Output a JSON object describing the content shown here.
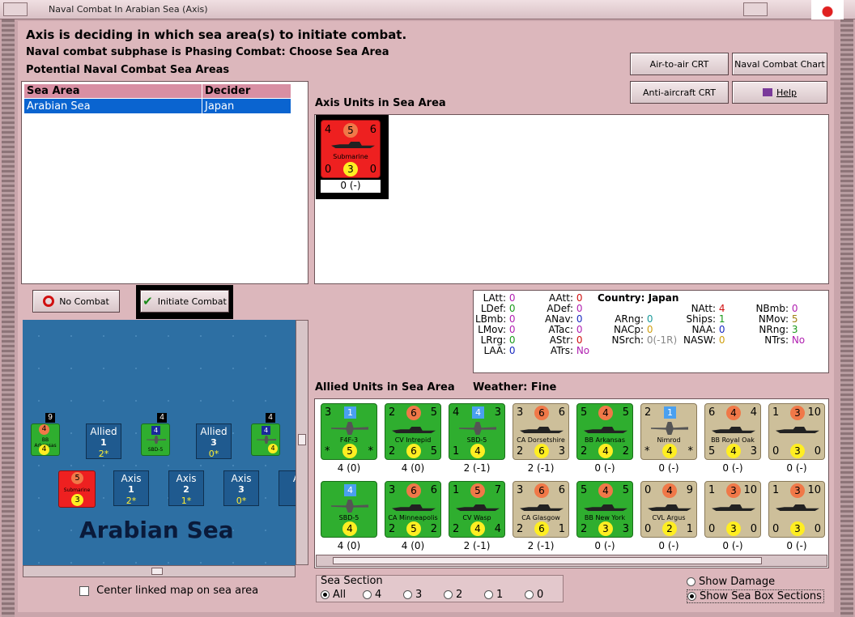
{
  "window": {
    "title": "Naval Combat In Arabian Sea (Axis)"
  },
  "header": {
    "line1": "Axis is deciding in which sea area(s) to initiate combat.",
    "line2": "Naval combat subphase is Phasing Combat: Choose Sea Area",
    "line3": "Potential Naval Combat Sea Areas"
  },
  "buttons": {
    "air_to_air": "Air-to-air CRT",
    "naval_combat_chart": "Naval Combat Chart",
    "anti_aircraft": "Anti-aircraft CRT",
    "help": "Help",
    "no_combat": "No Combat",
    "initiate_combat": "Initiate Combat"
  },
  "sea_table": {
    "headers": [
      "Sea Area",
      "Decider"
    ],
    "rows": [
      [
        "Arabian Sea",
        "Japan"
      ]
    ]
  },
  "axis_units": {
    "title": "Axis Units in Sea Area",
    "units": [
      {
        "name": "Submarine",
        "tl": "4",
        "tc": "5",
        "tr": "6",
        "bl": "0",
        "bc": "3",
        "br": "0",
        "label": "0 (-)"
      }
    ]
  },
  "stats": {
    "country_label": "Country:",
    "country": "Japan",
    "col1": [
      [
        "LAtt:",
        "0"
      ],
      [
        "LDef:",
        "0"
      ],
      [
        "LBmb:",
        "0"
      ],
      [
        "LMov:",
        "0"
      ],
      [
        "LRrg:",
        "0"
      ],
      [
        "LAA:",
        "0"
      ]
    ],
    "col2": [
      [
        "AAtt:",
        "0"
      ],
      [
        "ADef:",
        "0"
      ],
      [
        "ANav:",
        "0"
      ],
      [
        "ATac:",
        "0"
      ],
      [
        "AStr:",
        "0"
      ],
      [
        "ATrs:",
        "No"
      ]
    ],
    "col3": [
      [
        "ARng:",
        "0"
      ],
      [
        "NACp:",
        "0"
      ],
      [
        "NSrch:",
        "0(-1R)"
      ]
    ],
    "col4": [
      [
        "NAtt:",
        "4"
      ],
      [
        "Ships:",
        "1"
      ],
      [
        "NAA:",
        "0"
      ],
      [
        "NASW:",
        "0"
      ]
    ],
    "col5": [
      [
        "NBmb:",
        "0"
      ],
      [
        "NMov:",
        "5"
      ],
      [
        "NRng:",
        "3"
      ],
      [
        "NTrs:",
        "No"
      ]
    ]
  },
  "allied": {
    "title": "Allied Units in Sea Area",
    "weather_label": "Weather:",
    "weather": "Fine",
    "row1": [
      {
        "name": "F4F-3",
        "color": "green",
        "kind": "plane",
        "tl": "3",
        "tc": "1",
        "tr": "",
        "bl": "*",
        "bc": "5",
        "br": "*",
        "label": "4 (0)"
      },
      {
        "name": "CV Intrepid",
        "color": "green",
        "kind": "ship",
        "tl": "2",
        "tc": "6",
        "tr": "5",
        "bl": "2",
        "bc": "6",
        "br": "5",
        "label": "4 (0)"
      },
      {
        "name": "SBD-5",
        "color": "green",
        "kind": "plane",
        "tl": "4",
        "tc": "4",
        "tr": "3",
        "bl": "1",
        "bc": "4",
        "br": "",
        "label": "2 (-1)"
      },
      {
        "name": "CA Dorsetshire",
        "color": "tan",
        "kind": "ship",
        "tl": "3",
        "tc": "6",
        "tr": "6",
        "bl": "2",
        "bc": "6",
        "br": "3",
        "label": "2 (-1)"
      },
      {
        "name": "BB Arkansas",
        "color": "green",
        "kind": "ship",
        "tl": "5",
        "tc": "4",
        "tr": "5",
        "bl": "2",
        "bc": "4",
        "br": "2",
        "label": "0 (-)"
      },
      {
        "name": "Nimrod",
        "color": "tan",
        "kind": "plane",
        "tl": "2",
        "tc": "1",
        "tr": "",
        "bl": "*",
        "bc": "4",
        "br": "*",
        "label": "0 (-)"
      },
      {
        "name": "BB Royal Oak",
        "color": "tan",
        "kind": "ship",
        "tl": "6",
        "tc": "4",
        "tr": "4",
        "bl": "5",
        "bc": "4",
        "br": "3",
        "label": "0 (-)"
      },
      {
        "name": "",
        "color": "tan",
        "kind": "ship",
        "tl": "1",
        "tc": "3",
        "tr": "10",
        "bl": "0",
        "bc": "3",
        "br": "0",
        "label": "0 (-)"
      }
    ],
    "row2": [
      {
        "name": "SBD-5",
        "color": "green",
        "kind": "plane",
        "tl": "",
        "tc": "4",
        "tr": "",
        "bl": "",
        "bc": "4",
        "br": "",
        "label": "4 (0)"
      },
      {
        "name": "CA Minneapolis",
        "color": "green",
        "kind": "ship",
        "tl": "3",
        "tc": "6",
        "tr": "6",
        "bl": "2",
        "bc": "5",
        "br": "2",
        "label": "4 (0)"
      },
      {
        "name": "CV Wasp",
        "color": "green",
        "kind": "ship",
        "tl": "1",
        "tc": "5",
        "tr": "7",
        "bl": "2",
        "bc": "4",
        "br": "4",
        "label": "2 (-1)"
      },
      {
        "name": "CA Glasgow",
        "color": "tan",
        "kind": "ship",
        "tl": "3",
        "tc": "6",
        "tr": "6",
        "bl": "2",
        "bc": "6",
        "br": "1",
        "label": "2 (-1)"
      },
      {
        "name": "BB New York",
        "color": "green",
        "kind": "ship",
        "tl": "5",
        "tc": "4",
        "tr": "5",
        "bl": "2",
        "bc": "3",
        "br": "3",
        "label": "0 (-)"
      },
      {
        "name": "CVL Argus",
        "color": "tan",
        "kind": "ship",
        "tl": "0",
        "tc": "4",
        "tr": "9",
        "bl": "0",
        "bc": "2",
        "br": "1",
        "label": "0 (-)"
      },
      {
        "name": "",
        "color": "tan",
        "kind": "ship",
        "tl": "1",
        "tc": "3",
        "tr": "10",
        "bl": "0",
        "bc": "3",
        "br": "0",
        "label": "0 (-)"
      },
      {
        "name": "",
        "color": "tan",
        "kind": "ship",
        "tl": "1",
        "tc": "3",
        "tr": "10",
        "bl": "0",
        "bc": "3",
        "br": "0",
        "label": "0 (-)"
      }
    ]
  },
  "map": {
    "sea_name": "Arabian Sea",
    "allied_boxes": [
      {
        "side": "Allied",
        "num": "1",
        "sub": "2*"
      },
      {
        "side": "Allied",
        "num": "3",
        "sub": "0*"
      }
    ],
    "axis_boxes": [
      {
        "side": "Axis",
        "num": "1",
        "sub": "2*"
      },
      {
        "side": "Axis",
        "num": "2",
        "sub": "1*"
      },
      {
        "side": "Axis",
        "num": "3",
        "sub": "0*"
      },
      {
        "side": "A",
        "num": "",
        "sub": ""
      }
    ],
    "stack_counts": [
      "9",
      "4",
      "4"
    ],
    "units": {
      "bb_arkansas": "BB Arkansas",
      "sbd5": "SBD-5",
      "submarine": "Submarine"
    }
  },
  "center_map": "Center linked map on sea area",
  "sea_section": {
    "title": "Sea Section",
    "options": [
      "All",
      "4",
      "3",
      "2",
      "1",
      "0"
    ]
  },
  "show_damage": "Show Damage",
  "show_sections": "Show Sea Box Sections"
}
